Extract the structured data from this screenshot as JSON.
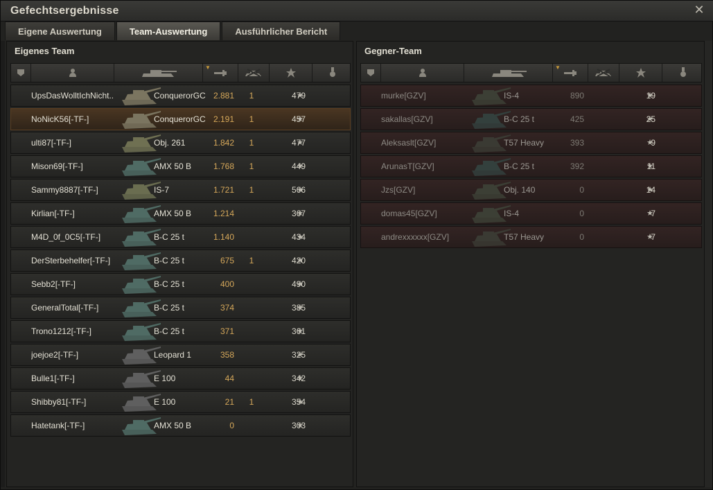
{
  "window": {
    "title": "Gefechtsergebnisse",
    "close_glyph": "✕"
  },
  "tabs": [
    {
      "label": "Eigene Auswertung",
      "active": false
    },
    {
      "label": "Team-Auswertung",
      "active": true
    },
    {
      "label": "Ausführlicher Bericht",
      "active": false
    }
  ],
  "icons": {
    "squad": "squad-icon",
    "player": "player-icon",
    "tank": "tank-icon",
    "damage": "damage-icon",
    "kills": "kills-icon",
    "xp": "star-icon",
    "medal": "medal-icon"
  },
  "colors": {
    "own_highlight": "#4a3622",
    "damage_text": "#d6a85a",
    "enemy_row": "#332423"
  },
  "own_team": {
    "title": "Eigenes Team",
    "rows": [
      {
        "player": "UpsDasWolltIchNicht..",
        "tank": "ConquerorGC",
        "damage": "2.881",
        "kills": "1",
        "xp": "479",
        "tank_color": "#7b7560",
        "highlight": false
      },
      {
        "player": "NoNicK56[-TF-]",
        "tank": "ConquerorGC",
        "damage": "2.191",
        "kills": "1",
        "xp": "457",
        "tank_color": "#7b7560",
        "highlight": true
      },
      {
        "player": "ulti87[-TF-]",
        "tank": "Obj. 261",
        "damage": "1.842",
        "kills": "1",
        "xp": "477",
        "tank_color": "#6f7052",
        "highlight": false
      },
      {
        "player": "Mison69[-TF-]",
        "tank": "AMX 50 B",
        "damage": "1.768",
        "kills": "1",
        "xp": "449",
        "tank_color": "#4f6b64",
        "highlight": false
      },
      {
        "player": "Sammy8887[-TF-]",
        "tank": "IS-7",
        "damage": "1.721",
        "kills": "1",
        "xp": "566",
        "tank_color": "#6a6d50",
        "highlight": false
      },
      {
        "player": "Kirlian[-TF-]",
        "tank": "AMX 50 B",
        "damage": "1.214",
        "kills": "",
        "xp": "367",
        "tank_color": "#4f6b64",
        "highlight": false
      },
      {
        "player": "M4D_0f_0C5[-TF-]",
        "tank": "B-C 25 t",
        "damage": "1.140",
        "kills": "",
        "xp": "434",
        "tank_color": "#4f6b64",
        "highlight": false
      },
      {
        "player": "DerSterbehelfer[-TF-]",
        "tank": "B-C 25 t",
        "damage": "675",
        "kills": "1",
        "xp": "420",
        "tank_color": "#4f6b64",
        "highlight": false
      },
      {
        "player": "Sebb2[-TF-]",
        "tank": "B-C 25 t",
        "damage": "400",
        "kills": "",
        "xp": "490",
        "tank_color": "#4f6b64",
        "highlight": false
      },
      {
        "player": "GeneralTotal[-TF-]",
        "tank": "B-C 25 t",
        "damage": "374",
        "kills": "",
        "xp": "385",
        "tank_color": "#4f6b64",
        "highlight": false
      },
      {
        "player": "Trono1212[-TF-]",
        "tank": "B-C 25 t",
        "damage": "371",
        "kills": "",
        "xp": "361",
        "tank_color": "#4f6b64",
        "highlight": false
      },
      {
        "player": "joejoe2[-TF-]",
        "tank": "Leopard 1",
        "damage": "358",
        "kills": "",
        "xp": "325",
        "tank_color": "#5f5f5f",
        "highlight": false
      },
      {
        "player": "Bulle1[-TF-]",
        "tank": "E 100",
        "damage": "44",
        "kills": "",
        "xp": "342",
        "tank_color": "#5f5f5f",
        "highlight": false
      },
      {
        "player": "Shibby81[-TF-]",
        "tank": "E 100",
        "damage": "21",
        "kills": "1",
        "xp": "354",
        "tank_color": "#5f5f5f",
        "highlight": false
      },
      {
        "player": "Hatetank[-TF-]",
        "tank": "AMX 50 B",
        "damage": "0",
        "kills": "",
        "xp": "303",
        "tank_color": "#4f6b64",
        "highlight": false
      }
    ]
  },
  "enemy_team": {
    "title": "Gegner-Team",
    "rows": [
      {
        "player": "murke[GZV]",
        "tank": "IS-4",
        "damage": "890",
        "kills": "",
        "xp": "19",
        "tank_color": "#3c3f35"
      },
      {
        "player": "sakallas[GZV]",
        "tank": "B-C 25 t",
        "damage": "425",
        "kills": "",
        "xp": "25",
        "tank_color": "#33403d"
      },
      {
        "player": "Aleksaslt[GZV]",
        "tank": "T57 Heavy",
        "damage": "393",
        "kills": "",
        "xp": "9",
        "tank_color": "#3a3a33"
      },
      {
        "player": "ArunasT[GZV]",
        "tank": "B-C 25 t",
        "damage": "392",
        "kills": "",
        "xp": "11",
        "tank_color": "#33403d"
      },
      {
        "player": "Jzs[GZV]",
        "tank": "Obj. 140",
        "damage": "0",
        "kills": "",
        "xp": "14",
        "tank_color": "#3c3f35"
      },
      {
        "player": "domas45[GZV]",
        "tank": "IS-4",
        "damage": "0",
        "kills": "",
        "xp": "7",
        "tank_color": "#3c3f35"
      },
      {
        "player": "andrexxxxxx[GZV]",
        "tank": "T57 Heavy",
        "damage": "0",
        "kills": "",
        "xp": "7",
        "tank_color": "#3a3a33"
      }
    ]
  }
}
